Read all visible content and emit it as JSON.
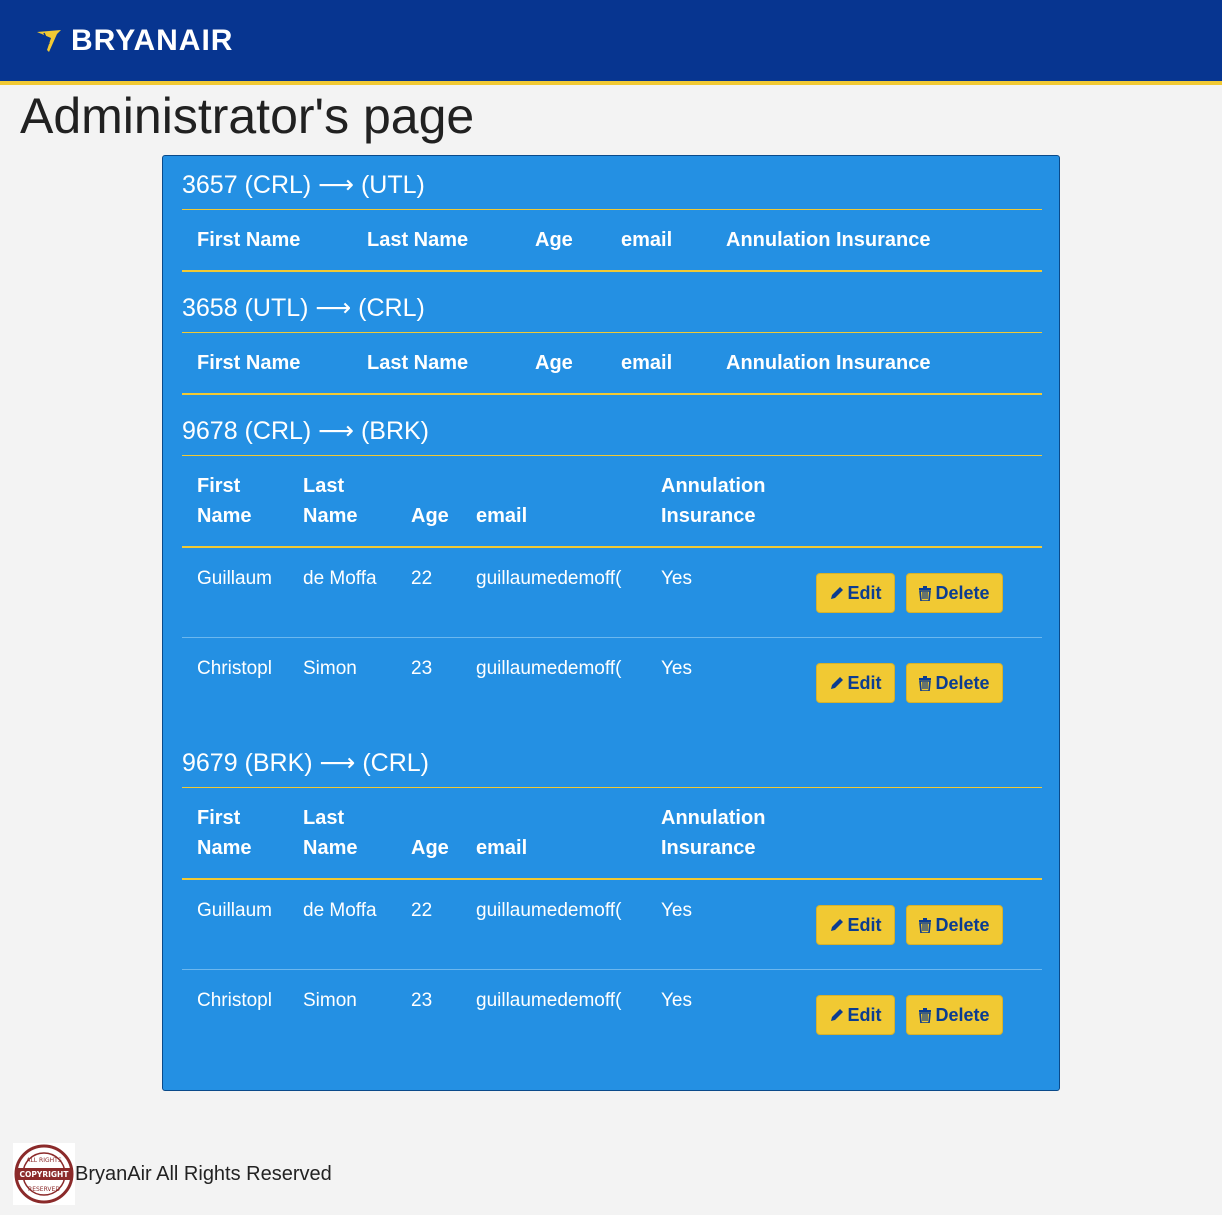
{
  "brand": {
    "name": "BRYANAIR",
    "accent": "#f1c933",
    "header_bg": "#073590",
    "panel_bg": "#2490e3"
  },
  "page": {
    "title": "Administrator's page"
  },
  "flights": [
    {
      "title": "3657 (CRL) ⟶ (UTL)",
      "columns": [
        "First Name",
        "Last Name",
        "Age",
        "email",
        "Annulation Insurance"
      ],
      "passengers": []
    },
    {
      "title": "3658 (UTL) ⟶ (CRL)",
      "columns": [
        "First Name",
        "Last Name",
        "Age",
        "email",
        "Annulation Insurance"
      ],
      "passengers": []
    },
    {
      "title": "9678 (CRL) ⟶ (BRK)",
      "columns_wrapped": [
        [
          "First",
          "Name"
        ],
        [
          "Last",
          "Name"
        ],
        [
          "",
          "Age"
        ],
        [
          "",
          "email"
        ],
        [
          "Annulation",
          "Insurance"
        ]
      ],
      "passengers": [
        {
          "first": "Guillaum",
          "last": "de Moffa",
          "age": "22",
          "email": "guillaumedemoff(",
          "insurance": "Yes"
        },
        {
          "first": "Christopl",
          "last": "Simon",
          "age": "23",
          "email": "guillaumedemoff(",
          "insurance": "Yes"
        }
      ]
    },
    {
      "title": "9679 (BRK) ⟶ (CRL)",
      "columns_wrapped": [
        [
          "First",
          "Name"
        ],
        [
          "Last",
          "Name"
        ],
        [
          "",
          "Age"
        ],
        [
          "",
          "email"
        ],
        [
          "Annulation",
          "Insurance"
        ]
      ],
      "passengers": [
        {
          "first": "Guillaum",
          "last": "de Moffa",
          "age": "22",
          "email": "guillaumedemoff(",
          "insurance": "Yes"
        },
        {
          "first": "Christopl",
          "last": "Simon",
          "age": "23",
          "email": "guillaumedemoff(",
          "insurance": "Yes"
        }
      ]
    }
  ],
  "actions": {
    "edit_label": "Edit",
    "delete_label": "Delete",
    "edit_icon": "pencil-icon",
    "delete_icon": "trash-icon"
  },
  "footer": {
    "text": "BryanAir All Rights Reserved",
    "seal_text": "COPYRIGHT ALL RIGHTS RESERVED"
  }
}
